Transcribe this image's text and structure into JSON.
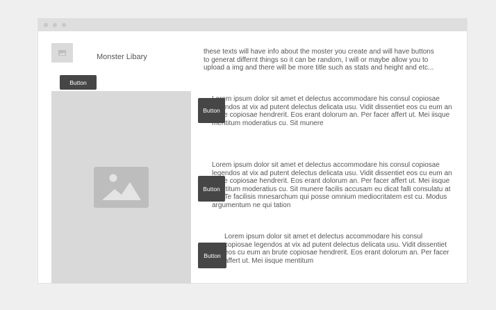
{
  "app": {
    "title": "Monster Libary",
    "top_button": "Button"
  },
  "main": {
    "intro": "these texts will have info about the moster you create and will have buttons to generat differnt things so it can be random, I will or maybe allow you to upload a img and there will be more title such as stats and height and etc...",
    "sections": [
      {
        "button": "Button",
        "text": "Lorem ipsum dolor sit amet et delectus accommodare his consul copiosae legendos at vix ad putent delectus delicata usu. Vidit dissentiet eos cu eum an brute copiosae hendrerit. Eos erant dolorum an. Per facer affert ut. Mei iisque mentitum moderatius cu. Sit munere"
      },
      {
        "button": "Button",
        "text": "Lorem ipsum dolor sit amet et delectus accommodare his consul copiosae legendos at vix ad putent delectus delicata usu. Vidit dissentiet eos cu eum an brute copiosae hendrerit. Eos erant dolorum an. Per facer affert ut. Mei iisque mentitum moderatius cu. Sit munere facilis accusam eu dicat falli consulatu at vis. Te facilisis mnesarchum qui posse omnium mediocritatem est cu. Modus argumentum ne qui tation"
      },
      {
        "button": "Button",
        "text": "Lorem ipsum dolor sit amet et delectus accommodare his consul copiosae legendos at vix ad putent delectus delicata usu. Vidit dissentiet eos cu eum an brute copiosae hendrerit. Eos erant dolorum an. Per facer affert ut. Mei iisque mentitum"
      }
    ]
  },
  "icons": {
    "logo": "image-icon",
    "placeholder": "image-icon"
  },
  "colors": {
    "button_bg": "#464646",
    "placeholder_bg": "#d9d9d9",
    "titlebar_bg": "#dedede"
  }
}
